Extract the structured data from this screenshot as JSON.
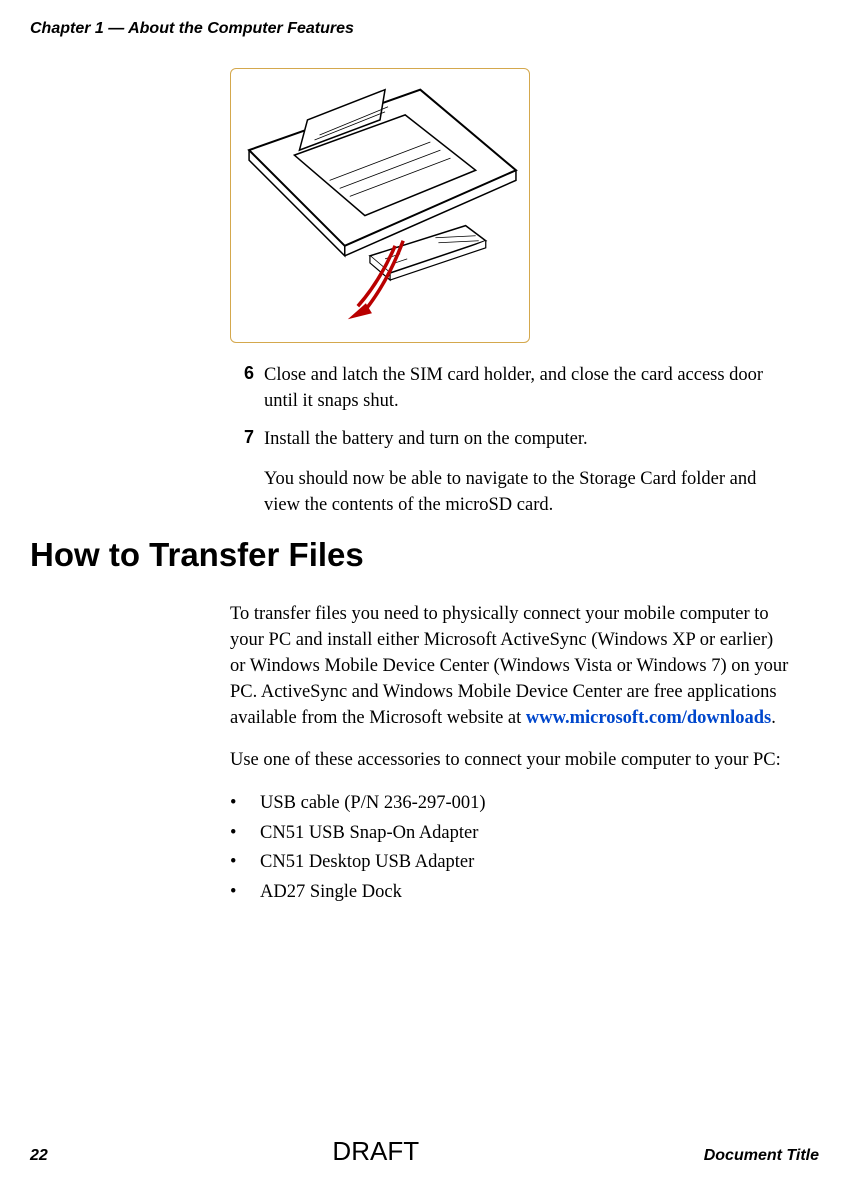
{
  "header": {
    "chapter": "Chapter 1 — About the Computer Features"
  },
  "steps": [
    {
      "num": "6",
      "text": "Close and latch the SIM card holder, and close the card access door until it snaps shut."
    },
    {
      "num": "7",
      "text": "Install the battery and turn on the computer."
    }
  ],
  "follow_text": "You should now be able to navigate to the Storage Card folder and view the contents of the microSD card.",
  "section_heading": "How to Transfer Files",
  "para1_pre": "To transfer files you need to physically connect your mobile computer to your PC and install either Microsoft ActiveSync (Windows XP or earlier) or Windows Mobile Device Center (Windows Vista or Windows 7) on your PC. ActiveSync and Windows Mobile Device Center are free applications available from the Microsoft website at ",
  "para1_link": "www.microsoft.com/downloads",
  "para1_post": ".",
  "para2": "Use one of these accessories to connect your mobile computer to your PC:",
  "bullets": [
    "USB cable (P/N 236-297-001)",
    "CN51 USB Snap-On Adapter",
    "CN51 Desktop USB Adapter",
    "AD27 Single Dock"
  ],
  "footer": {
    "page": "22",
    "watermark": "DRAFT",
    "title": "Document Title"
  }
}
